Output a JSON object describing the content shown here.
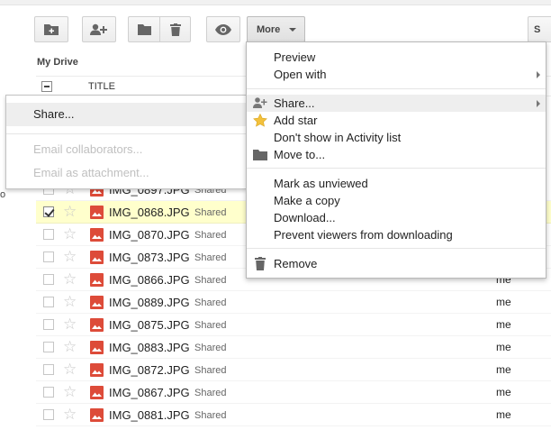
{
  "toolbar": {
    "new_folder_icon": "new-folder-icon",
    "add_user_icon": "add-user-icon",
    "move_icon": "folder-icon",
    "delete_icon": "trash-icon",
    "preview_icon": "eye-icon",
    "more_label": "More",
    "right_button_label": "S"
  },
  "list": {
    "location": "My Drive",
    "title_header": "TITLE",
    "left_mark": "o",
    "rows": [
      {
        "name": "IMG_0897.JPG",
        "shared": "Shared",
        "owner": "",
        "checked": false,
        "selected": false
      },
      {
        "name": "IMG_0868.JPG",
        "shared": "Shared",
        "owner": "",
        "checked": true,
        "selected": true
      },
      {
        "name": "IMG_0870.JPG",
        "shared": "Shared",
        "owner": "",
        "checked": false,
        "selected": false
      },
      {
        "name": "IMG_0873.JPG",
        "shared": "Shared",
        "owner": "",
        "checked": false,
        "selected": false
      },
      {
        "name": "IMG_0866.JPG",
        "shared": "Shared",
        "owner": "me",
        "checked": false,
        "selected": false
      },
      {
        "name": "IMG_0889.JPG",
        "shared": "Shared",
        "owner": "me",
        "checked": false,
        "selected": false
      },
      {
        "name": "IMG_0875.JPG",
        "shared": "Shared",
        "owner": "me",
        "checked": false,
        "selected": false
      },
      {
        "name": "IMG_0883.JPG",
        "shared": "Shared",
        "owner": "me",
        "checked": false,
        "selected": false
      },
      {
        "name": "IMG_0872.JPG",
        "shared": "Shared",
        "owner": "me",
        "checked": false,
        "selected": false
      },
      {
        "name": "IMG_0867.JPG",
        "shared": "Shared",
        "owner": "me",
        "checked": false,
        "selected": false
      },
      {
        "name": "IMG_0881.JPG",
        "shared": "Shared",
        "owner": "me",
        "checked": false,
        "selected": false
      }
    ]
  },
  "share_popup": {
    "share": "Share...",
    "email_collaborators": "Email collaborators...",
    "email_attachment": "Email as attachment..."
  },
  "more_menu": {
    "preview": "Preview",
    "open_with": "Open with",
    "share": "Share...",
    "add_star": "Add star",
    "dont_show": "Don't show in Activity list",
    "move_to": "Move to...",
    "mark_unviewed": "Mark as unviewed",
    "make_copy": "Make a copy",
    "download": "Download...",
    "prevent_download": "Prevent viewers from downloading",
    "remove": "Remove"
  },
  "colors": {
    "accent_red": "#dd4b39",
    "selected_row": "#ffffcc",
    "star_yellow": "#f3c13c"
  }
}
